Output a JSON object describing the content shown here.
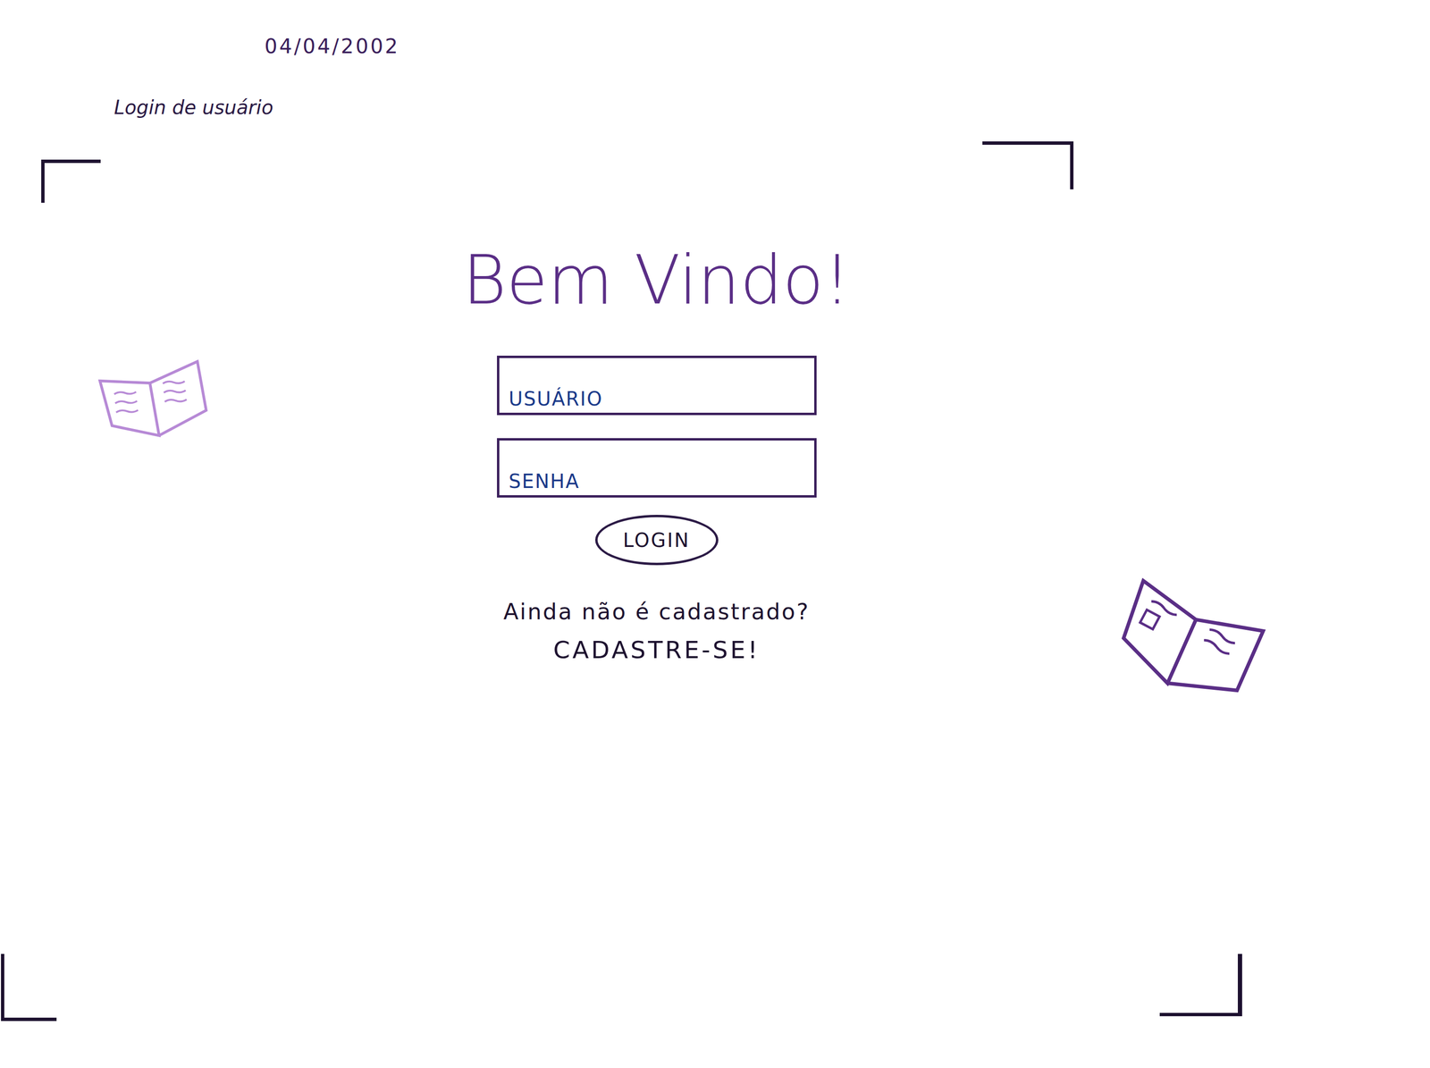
{
  "header": {
    "date": "04/04/2002",
    "title": "Login de usuário"
  },
  "heading": "Bem Vindo!",
  "fields": [
    {
      "label": "USUÁRIO"
    },
    {
      "label": "SENHA"
    }
  ],
  "button": "LOGIN",
  "signup": {
    "prompt": "Ainda não é cadastrado?",
    "link": "CADASTRE-SE!"
  }
}
